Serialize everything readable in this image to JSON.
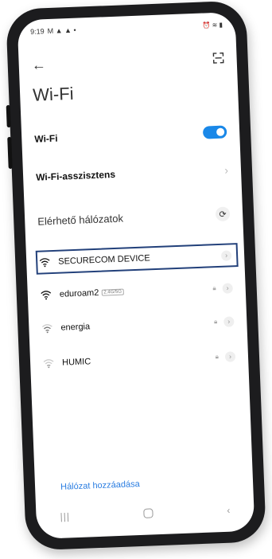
{
  "status": {
    "time": "9:19",
    "left_icons": "M ▲ ▲ •",
    "right_icons": "⏰ ≋ ▮"
  },
  "page": {
    "title": "Wi-Fi"
  },
  "wifi_toggle": {
    "label": "Wi-Fi",
    "on": true
  },
  "assistant": {
    "label": "Wi-Fi-asszisztens"
  },
  "networks_section": {
    "label": "Elérhető hálózatok"
  },
  "networks": [
    {
      "name": "SECURECOM DEVICE",
      "badge": "",
      "locked": false,
      "strength": "full"
    },
    {
      "name": "eduroam2",
      "badge": "2.4G/5G",
      "locked": true,
      "strength": "full"
    },
    {
      "name": "energia",
      "badge": "",
      "locked": true,
      "strength": "medium"
    },
    {
      "name": "HUMIC",
      "badge": "",
      "locked": true,
      "strength": "low"
    }
  ],
  "add_network": {
    "label": "Hálózat hozzáadása"
  },
  "colors": {
    "accent": "#1a88e8",
    "highlight_border": "#22407a",
    "link": "#2a7de1"
  }
}
